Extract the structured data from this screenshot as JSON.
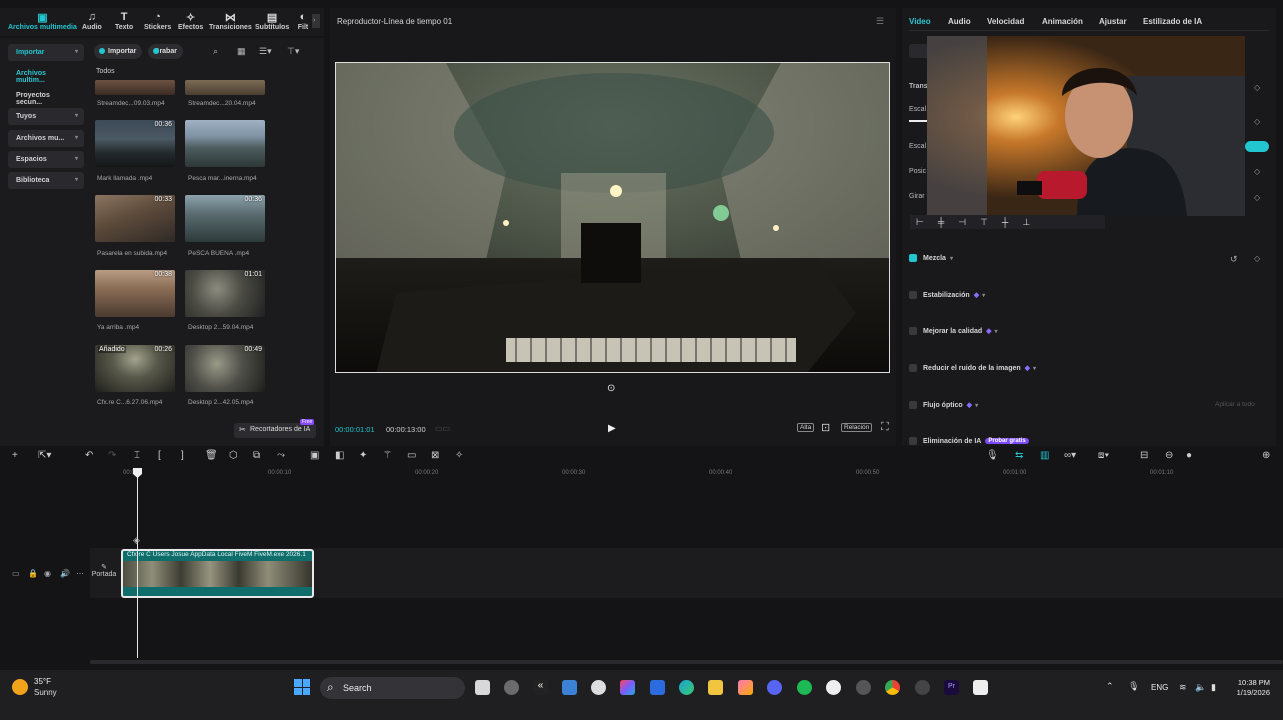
{
  "media_toolbar": {
    "items": [
      "Archivos multimedia",
      "Audio",
      "Texto",
      "Stickers",
      "Efectos",
      "Transiciones",
      "Subtítulos",
      "Filt"
    ]
  },
  "sidebar": {
    "items": [
      "Importar",
      "Archivos multim...",
      "Proyectos secun...",
      "Tuyos",
      "Archivos mu...",
      "Espacios",
      "Biblioteca"
    ]
  },
  "media_top": {
    "import": "Importar",
    "record": "Grabar"
  },
  "media_section": "Todos",
  "media_items": [
    {
      "name": "Streamdec...09.03.mp4",
      "duration": ""
    },
    {
      "name": "Streamdec...20.04.mp4",
      "duration": ""
    },
    {
      "name": "Mark llamada .mp4",
      "duration": "00:36"
    },
    {
      "name": "Pesca mar...inerna.mp4",
      "duration": ""
    },
    {
      "name": "Pasarela en subida.mp4",
      "duration": "00:33"
    },
    {
      "name": "PeSCA BUENA .mp4",
      "duration": "00:36"
    },
    {
      "name": "Ya arriba .mp4",
      "duration": "00:38"
    },
    {
      "name": "Desktop 2...59.04.mp4",
      "duration": "01:01"
    },
    {
      "name": "Cfx.re  C...6.27.06.mp4",
      "duration": "00:26",
      "badge": "Añadido"
    },
    {
      "name": "Desktop 2...42.05.mp4",
      "duration": "00:49"
    }
  ],
  "recortadores": {
    "label": "Recortadores de IA",
    "badge": "Free"
  },
  "player": {
    "title": "Reproductor-Línea de tiempo 01",
    "current_time": "00:00:01:01",
    "total_time": "00:00:13:00",
    "quality": "Alta",
    "ratio": "Relación"
  },
  "right_panel": {
    "tabs": [
      "Video",
      "Audio",
      "Velocidad",
      "Animación",
      "Ajustar",
      "Estilizado de IA"
    ],
    "labels": [
      "Trans",
      "Escal",
      "Escal",
      "Posic",
      "Girar"
    ],
    "options": [
      {
        "label": "Mezcla",
        "checked": true
      },
      {
        "label": "Estabilización",
        "checked": false
      },
      {
        "label": "Mejorar la calidad",
        "checked": false
      },
      {
        "label": "Reducir el ruido de la imagen",
        "checked": false
      },
      {
        "label": "Flujo óptico",
        "checked": false
      },
      {
        "label": "Eliminación de IA",
        "checked": false
      }
    ],
    "apply_all": "Aplicar a todo",
    "trial_badge": "Probar gratis"
  },
  "timeline": {
    "ruler": [
      "00:00",
      "00:00:10",
      "00:00:20",
      "00:00:30",
      "00:00:40",
      "00:00:50",
      "00:01:00",
      "00:01:10"
    ],
    "clip_label": "Cfx.re  C  Users Josue AppData Local FiveM FiveM.exe 2026.1",
    "cover": "Portada"
  },
  "taskbar": {
    "temp": "35°F",
    "condition": "Sunny",
    "search": "Search",
    "lang": "ENG",
    "time": "10:38 PM",
    "date": "1/19/2026"
  },
  "colors": {
    "accent": "#22c6d0",
    "clip": "#0f6d6b"
  }
}
